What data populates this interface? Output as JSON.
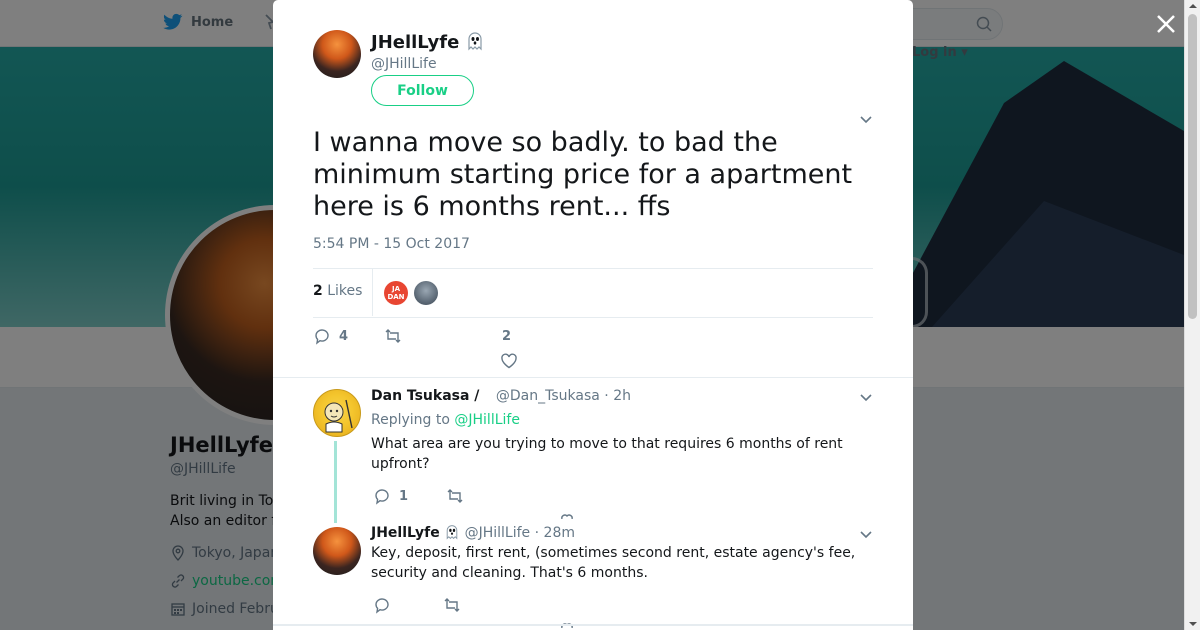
{
  "background": {
    "topbar": {
      "home_label": "Home",
      "login_label": "Log in"
    },
    "profile": {
      "name": "JHellLyfe",
      "handle": "@JHillLife",
      "bio_line1": "Brit living in To",
      "bio_line2": "Also an editor f",
      "location": "Tokyo, Japan",
      "website": "youtube.com",
      "joined": "Joined Febru"
    }
  },
  "modal": {
    "author": {
      "name": "JHellLyfe",
      "handle": "@JHillLife",
      "follow_label": "Follow"
    },
    "tweet": {
      "text": "I wanna move so badly. to bad the minimum starting price for a apartment here is 6 months rent... ffs",
      "timestamp": "5:54 PM - 15 Oct 2017",
      "likes_count": "2",
      "likes_label": "Likes",
      "liker1_initials": "JA DAN",
      "reply_count": "4",
      "like_count_action": "2"
    },
    "replies": [
      {
        "name": "Dan Tsukasa /",
        "handle": "@Dan_Tsukasa",
        "time": "2h",
        "replying_prefix": "Replying to",
        "replying_to": "@JHillLife",
        "text": "What area are you trying to move to that requires 6 months of rent upfront?",
        "reply_count": "1"
      },
      {
        "name": "JHellLyfe",
        "handle": "@JHillLife",
        "time": "28m",
        "text": "Key, deposit, first rent, (sometimes second rent, estate agency's fee, security and cleaning. That's 6 months."
      }
    ]
  },
  "colors": {
    "accent": "#19cf86",
    "twitter_blue": "#1da1f2",
    "muted": "#657786"
  }
}
